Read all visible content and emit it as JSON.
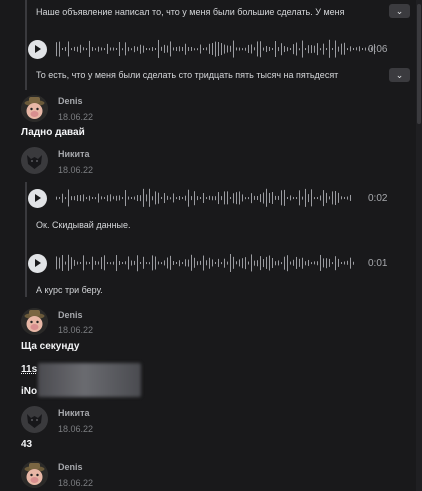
{
  "messages": [
    {
      "transcript": "Наше объявление написал то, что у меня были большие сделать. У меня"
    },
    {
      "duration": "0:06"
    },
    {
      "transcript": "То есть, что у меня были сделать сто тридцать пять тысяч на пятьдесят"
    }
  ],
  "denis1": {
    "name": "Denis",
    "date": "18.06.22",
    "text": "Ладно давай"
  },
  "nikita1": {
    "name": "Никита",
    "date": "18.06.22",
    "voice1": {
      "duration": "0:02",
      "transcript": "Ок. Скидывай данные."
    },
    "voice2": {
      "duration": "0:01",
      "transcript": "А курс три беру."
    }
  },
  "denis2": {
    "name": "Denis",
    "date": "18.06.22",
    "text1": "Ща секунду",
    "text2": "11s",
    "text3": "iNo"
  },
  "nikita2": {
    "name": "Никита",
    "date": "18.06.22",
    "text": "43"
  },
  "denis3": {
    "name": "Denis",
    "date": "18.06.22"
  },
  "icons": {
    "expand": "chevron-down-icon",
    "play": "play-icon"
  }
}
